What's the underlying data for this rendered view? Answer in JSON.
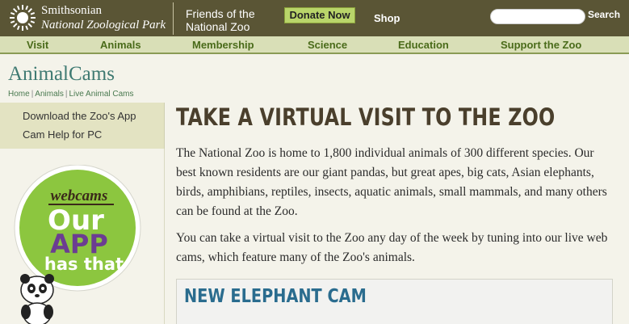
{
  "header": {
    "logo_line1": "Smithsonian",
    "logo_line2": "National Zoological Park",
    "friends_line1": "Friends of the",
    "friends_line2": "National Zoo",
    "donate_label": "Donate Now",
    "shop_label": "Shop",
    "search_placeholder": "",
    "search_label": "Search"
  },
  "nav": {
    "items": [
      "Visit",
      "Animals",
      "Membership",
      "Science",
      "Education",
      "Support the Zoo"
    ]
  },
  "section": {
    "title": "AnimalCams",
    "breadcrumb": [
      "Home",
      "Animals",
      "Live Animal Cams"
    ]
  },
  "sidebar": {
    "links": [
      "Download the Zoo's App",
      "Cam Help for PC"
    ]
  },
  "badge": {
    "top_text": "webcams",
    "line1": "Our",
    "line2": "APP",
    "line3": "has that"
  },
  "main": {
    "title": "TAKE A VIRTUAL VISIT TO THE ZOO",
    "paragraph1": "The National Zoo is home to 1,800 individual animals of 300 different species. Our best known residents are our giant pandas, but great apes, big cats, Asian elephants, birds, amphibians, reptiles, insects, aquatic animals, small mammals, and many others can be found at the Zoo.",
    "paragraph2": "You can take a virtual visit to the Zoo any day of the week by tuning into our live web cams, which feature many of the Zoo's animals.",
    "feature_title": "NEW ELEPHANT CAM",
    "feature_text": ""
  },
  "colors": {
    "topbar": "#5a5535",
    "nav_bg": "#d9dfb7",
    "nav_text": "#4a6b1a",
    "donate_bg": "#b9d56a",
    "section_title": "#3f7a72",
    "feature_title": "#2a6c8e",
    "badge_green": "#8cc63f",
    "badge_purple": "#6b3d91"
  }
}
